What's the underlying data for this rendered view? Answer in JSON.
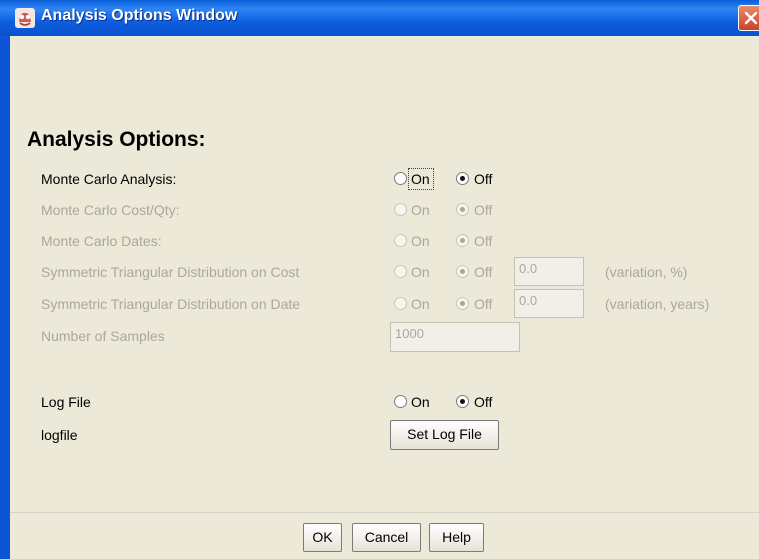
{
  "window": {
    "title": "Analysis Options Window"
  },
  "heading": "Analysis Options:",
  "radio_labels": {
    "on": "On",
    "off": "Off"
  },
  "options": [
    {
      "label": "Monte Carlo Analysis:",
      "enabled": true,
      "selected": "Off"
    },
    {
      "label": "Monte Carlo Cost/Qty:",
      "enabled": false,
      "selected": "Off"
    },
    {
      "label": "Monte Carlo Dates:",
      "enabled": false,
      "selected": "Off"
    },
    {
      "label": "Symmetric Triangular Distribution on Cost",
      "enabled": false,
      "selected": "Off",
      "value": "0.0",
      "unit": "(variation, %)"
    },
    {
      "label": "Symmetric Triangular Distribution on Date",
      "enabled": false,
      "selected": "Off",
      "value": "0.0",
      "unit": "(variation, years)"
    },
    {
      "label": "Number of Samples",
      "enabled": false,
      "value": "1000"
    },
    {
      "label": "Log File",
      "enabled": true,
      "selected": "Off"
    },
    {
      "label": "logfile",
      "enabled": true,
      "button": "Set Log File"
    }
  ],
  "buttons": {
    "ok": "OK",
    "cancel": "Cancel",
    "help": "Help"
  }
}
